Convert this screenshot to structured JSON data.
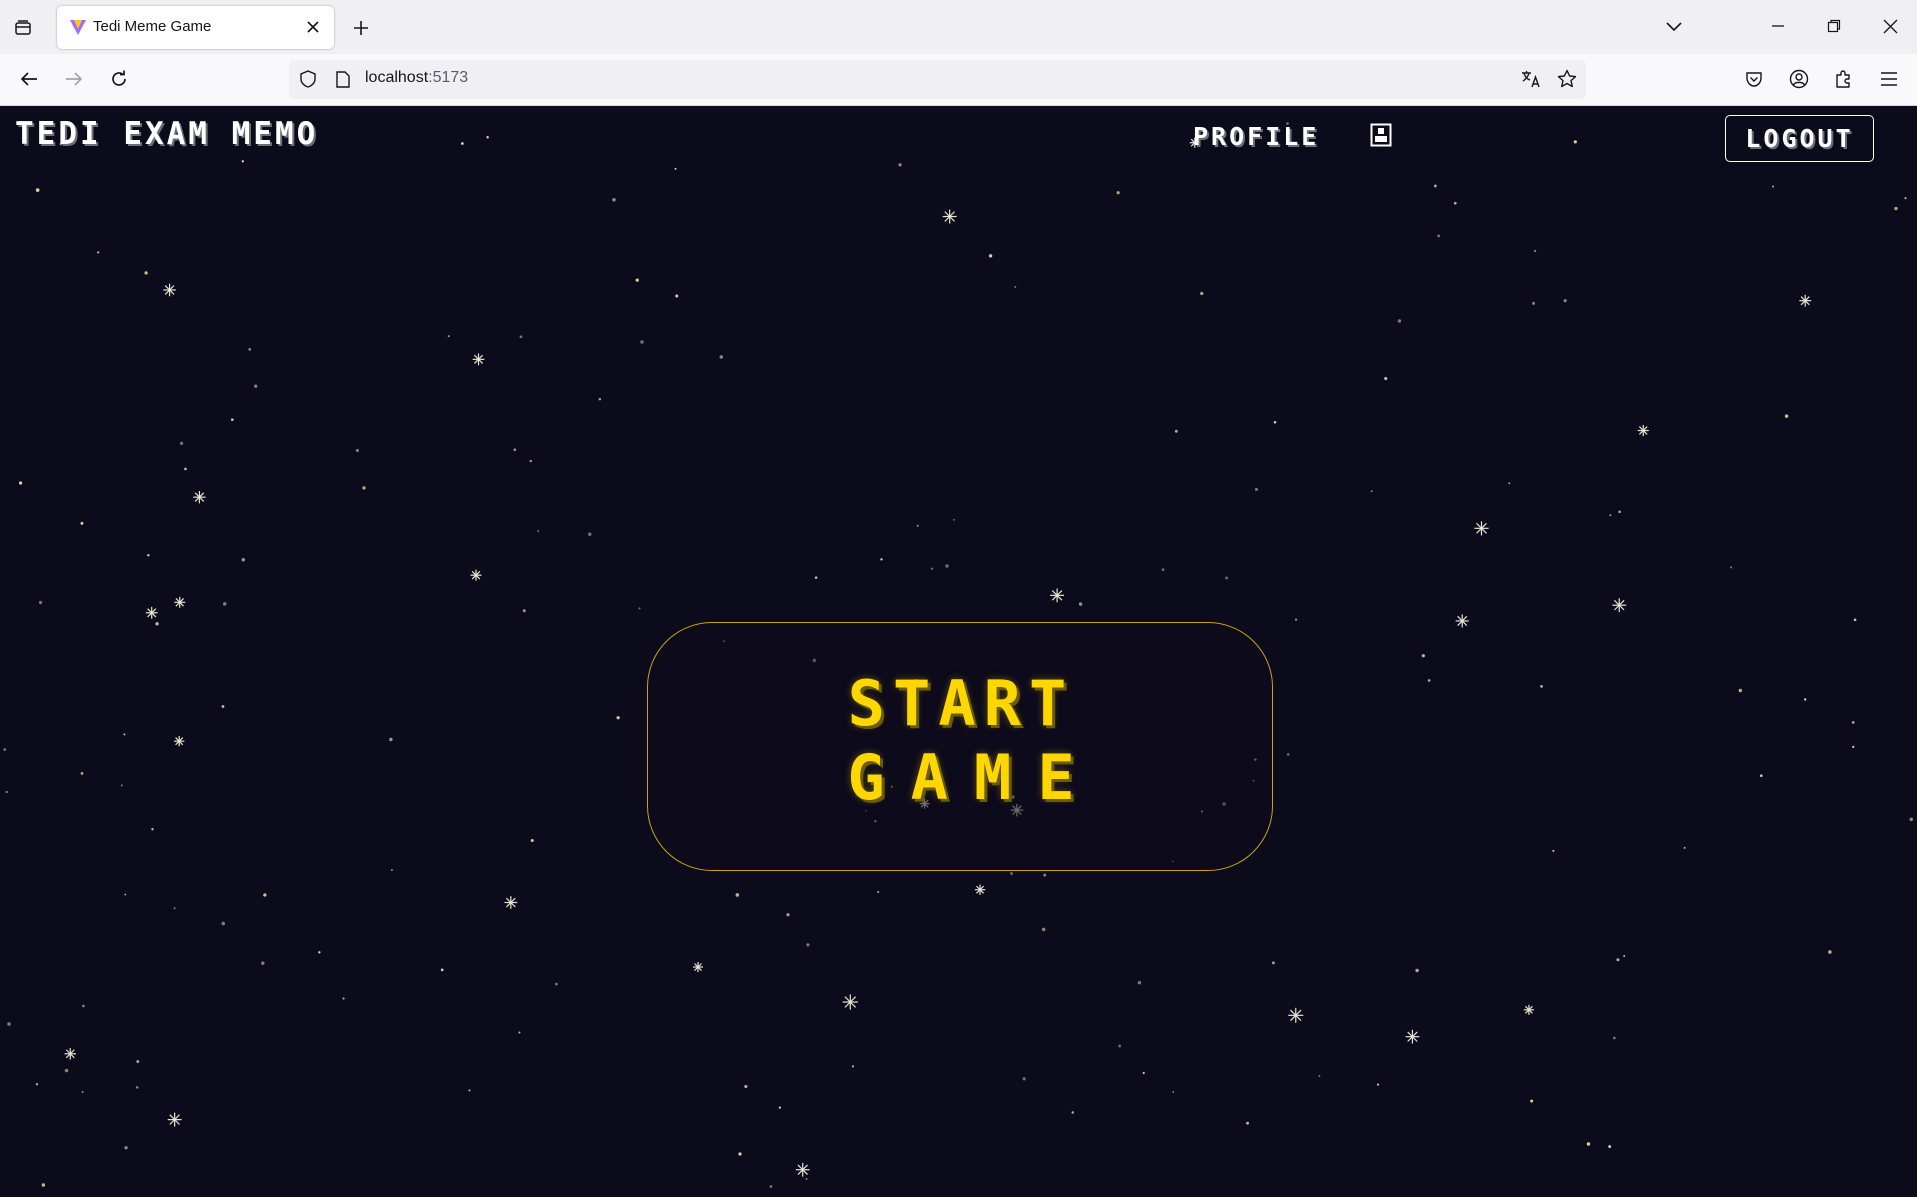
{
  "browser": {
    "tab": {
      "title": "Tedi Meme Game"
    },
    "url": {
      "host": "localhost",
      "port": ":5173"
    },
    "icons": [
      "tab-overview-icon",
      "new-tab-icon",
      "list-all-tabs-icon",
      "minimize-icon",
      "restore-icon",
      "close-window-icon",
      "back-icon",
      "forward-icon",
      "reload-icon",
      "shield-icon",
      "page-icon",
      "translate-icon",
      "bookmark-star-icon",
      "pocket-icon",
      "account-icon",
      "extensions-icon",
      "menu-icon"
    ]
  },
  "header": {
    "logo": "TEDI EXAM MEMO",
    "profile_label": "PROFILE",
    "logout_label": "LOGOUT"
  },
  "main": {
    "start_line1": "START",
    "start_line2": "GAME"
  },
  "colors": {
    "background": "#0c0b1c",
    "accent": "#ffd700",
    "star": "#f3e7a6",
    "text": "#ffffff"
  }
}
